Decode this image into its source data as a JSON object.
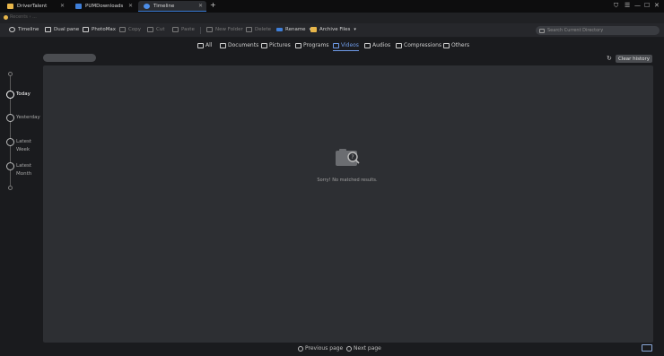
{
  "tabs": [
    {
      "label": "DriverTalent",
      "icon": "folder-icon"
    },
    {
      "label": "PUMDownloads",
      "icon": "app-icon"
    },
    {
      "label": "Timeline",
      "icon": "globe-icon",
      "active": true
    }
  ],
  "window_controls": {
    "shield": "⛉",
    "menu": "☰",
    "minimize": "—",
    "maximize": "☐",
    "close": "✕"
  },
  "address": {
    "text": "Recents  ›  ..."
  },
  "toolbar": {
    "timeline": "Timeline",
    "dual_pane": "Dual pane",
    "photomax": "PhotoMax",
    "copy": "Copy",
    "cut": "Cut",
    "paste": "Paste",
    "new_folder": "New Folder",
    "delete": "Delete",
    "rename": "Rename",
    "archive": "Archive Files",
    "search_placeholder": "Search Current Directory"
  },
  "categories": [
    {
      "label": "All",
      "icon": "all-icon"
    },
    {
      "label": "Documents",
      "icon": "document-icon"
    },
    {
      "label": "Pictures",
      "icon": "picture-icon"
    },
    {
      "label": "Programs",
      "icon": "program-icon"
    },
    {
      "label": "Videos",
      "icon": "video-icon",
      "active": true
    },
    {
      "label": "Audios",
      "icon": "audio-icon"
    },
    {
      "label": "Compressions",
      "icon": "archive-icon"
    },
    {
      "label": "Others",
      "icon": "others-icon"
    }
  ],
  "clear_history": "Clear history",
  "timeline": [
    {
      "label": "Today",
      "active": true
    },
    {
      "label": "Yesterday"
    },
    {
      "label": "Latest Week"
    },
    {
      "label": "Latest Month"
    }
  ],
  "empty_state": {
    "message": "Sorry! No matched results."
  },
  "pager": {
    "previous": "Previous page",
    "next": "Next page"
  },
  "colors": {
    "accent": "#6f9be8",
    "panel": "#2d2f33",
    "background": "#1a1b1e"
  }
}
